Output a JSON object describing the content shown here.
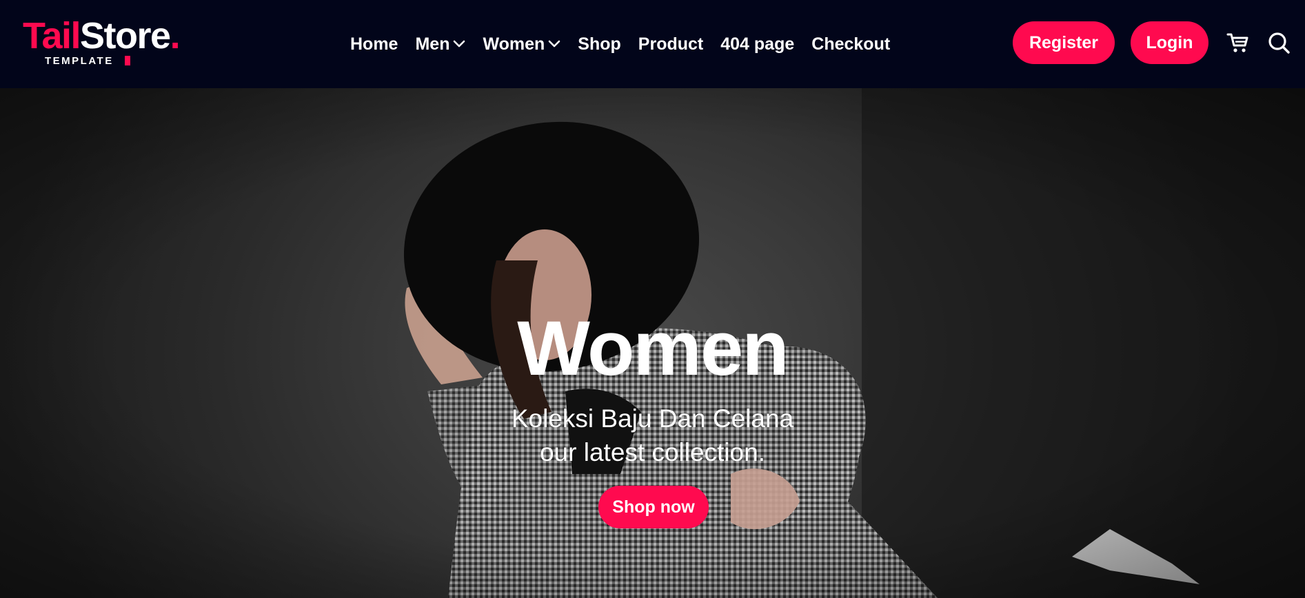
{
  "brand": {
    "name_part1": "Tail",
    "name_part2": "Store",
    "name_dot": ".",
    "subtitle": "TEMPLATE",
    "accent_color": "#ff0a4f"
  },
  "nav": {
    "items": [
      {
        "label": "Home",
        "has_dropdown": false
      },
      {
        "label": "Men",
        "has_dropdown": true,
        "icon": "chevron-down-icon"
      },
      {
        "label": "Women",
        "has_dropdown": true,
        "icon": "chevron-down-icon"
      },
      {
        "label": "Shop",
        "has_dropdown": false
      },
      {
        "label": "Product",
        "has_dropdown": false
      },
      {
        "label": "404 page",
        "has_dropdown": false
      },
      {
        "label": "Checkout",
        "has_dropdown": false
      }
    ]
  },
  "actions": {
    "register_label": "Register",
    "login_label": "Login",
    "cart_icon": "cart-icon",
    "search_icon": "search-icon"
  },
  "hero": {
    "title": "Women",
    "subtitle_line1": "Koleksi Baju Dan Celana",
    "subtitle_line2": "our latest collection.",
    "cta_label": "Shop now"
  },
  "colors": {
    "header_bg": "#02051a",
    "accent": "#ff0a4f",
    "text": "#ffffff"
  }
}
